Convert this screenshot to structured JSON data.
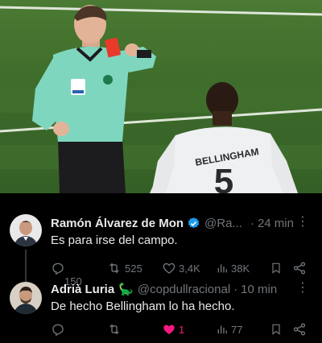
{
  "tweets": [
    {
      "name": "Ramón Álvarez de Mon",
      "verified": true,
      "handle": "@Ra...",
      "separator": "·",
      "time": "24 min",
      "more": "⋮",
      "text": "Es para irse del campo.",
      "replies": "150",
      "retweets": "525",
      "likes": "3,4K",
      "views": "38K",
      "liked": false
    },
    {
      "name": "Adrià Luria",
      "emoji": "🦕",
      "handle": "@copdullracional",
      "separator": "·",
      "time": "10 min",
      "more": "⋮",
      "text": "De hecho Bellingham lo ha hecho.",
      "replies": "",
      "retweets": "",
      "likes": "1",
      "views": "77",
      "liked": true
    }
  ],
  "photo": {
    "shirt_name": "BELLINGHAM",
    "shirt_number": "5"
  },
  "colors": {
    "background": "#000000",
    "text": "#e7e9ea",
    "muted": "#71767b",
    "verified": "#1d9bf0",
    "like": "#f91880",
    "pitch": "#3f6a2c",
    "referee_shirt": "#7fd6bf",
    "red_card": "#e8392b"
  }
}
